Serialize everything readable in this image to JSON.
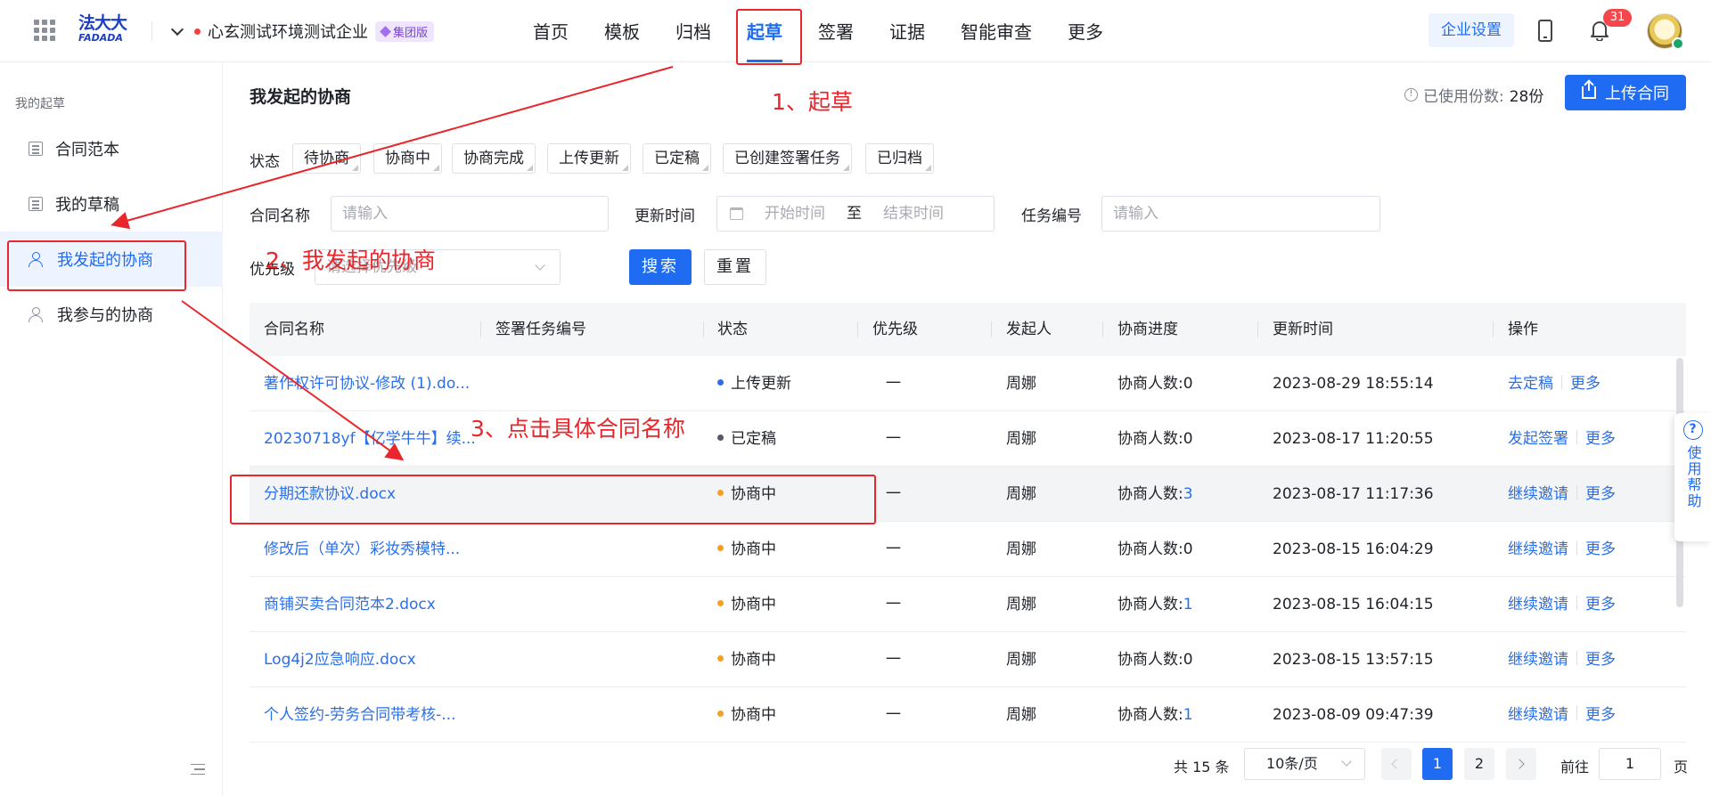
{
  "topbar": {
    "logo_cn": "法大大",
    "logo_en": "FADADA",
    "org_name": "心玄测试环境测试企业",
    "org_tag": "集团版",
    "nav": [
      "首页",
      "模板",
      "归档",
      "起草",
      "签署",
      "证据",
      "智能审查",
      "更多"
    ],
    "active_nav": "起草",
    "enterprise_settings": "企业设置",
    "notification_count": "31"
  },
  "sidebar": {
    "section_title": "我的起草",
    "items": [
      {
        "label": "合同范本"
      },
      {
        "label": "我的草稿"
      },
      {
        "label": "我发起的协商"
      },
      {
        "label": "我参与的协商"
      }
    ]
  },
  "main": {
    "title": "我发起的协商",
    "used_label": "已使用份数:",
    "used_count": "28份",
    "upload_button": "上传合同",
    "filters": {
      "status_label": "状态",
      "statuses": [
        "待协商",
        "协商中",
        "协商完成",
        "上传更新",
        "已定稿",
        "已创建签署任务",
        "已归档"
      ],
      "contract_name_label": "合同名称",
      "contract_name_placeholder": "请输入",
      "update_time_label": "更新时间",
      "start_placeholder": "开始时间",
      "to_label": "至",
      "end_placeholder": "结束时间",
      "task_no_label": "任务编号",
      "task_no_placeholder": "请输入",
      "priority_label": "优先级",
      "priority_placeholder": "请选择优先级",
      "search_button": "搜索",
      "reset_button": "重置"
    },
    "table": {
      "columns": [
        "合同名称",
        "签署任务编号",
        "状态",
        "优先级",
        "发起人",
        "协商进度",
        "更新时间",
        "操作"
      ],
      "rows": [
        {
          "name": "著作权许可协议-修改 (1).do...",
          "task_no": "",
          "status": "上传更新",
          "status_color": "#2b6fe8",
          "priority": "一",
          "initiator": "周娜",
          "progress_label": "协商人数:",
          "progress_count": "0",
          "updated": "2023-08-29 18:55:14",
          "action": "去定稿",
          "more": "更多"
        },
        {
          "name": "20230718yf【亿学牛牛】续...",
          "task_no": "",
          "status": "已定稿",
          "status_color": "#555a63",
          "priority": "一",
          "initiator": "周娜",
          "progress_label": "协商人数:",
          "progress_count": "0",
          "updated": "2023-08-17 11:20:55",
          "action": "发起签署",
          "more": "更多"
        },
        {
          "name": "分期还款协议.docx",
          "task_no": "",
          "status": "协商中",
          "status_color": "#f5a020",
          "priority": "一",
          "initiator": "周娜",
          "progress_label": "协商人数:",
          "progress_count": "3",
          "updated": "2023-08-17 11:17:36",
          "action": "继续邀请",
          "more": "更多"
        },
        {
          "name": "修改后（单次）彩妆秀模特...",
          "task_no": "",
          "status": "协商中",
          "status_color": "#f5a020",
          "priority": "一",
          "initiator": "周娜",
          "progress_label": "协商人数:",
          "progress_count": "0",
          "updated": "2023-08-15 16:04:29",
          "action": "继续邀请",
          "more": "更多"
        },
        {
          "name": "商铺买卖合同范本2.docx",
          "task_no": "",
          "status": "协商中",
          "status_color": "#f5a020",
          "priority": "一",
          "initiator": "周娜",
          "progress_label": "协商人数:",
          "progress_count": "1",
          "updated": "2023-08-15 16:04:15",
          "action": "继续邀请",
          "more": "更多"
        },
        {
          "name": "Log4j2应急响应.docx",
          "task_no": "",
          "status": "协商中",
          "status_color": "#f5a020",
          "priority": "一",
          "initiator": "周娜",
          "progress_label": "协商人数:",
          "progress_count": "0",
          "updated": "2023-08-15 13:57:15",
          "action": "继续邀请",
          "more": "更多"
        },
        {
          "name": "个人签约-劳务合同带考核-...",
          "task_no": "",
          "status": "协商中",
          "status_color": "#f5a020",
          "priority": "一",
          "initiator": "周娜",
          "progress_label": "协商人数:",
          "progress_count": "1",
          "updated": "2023-08-09 09:47:39",
          "action": "继续邀请",
          "more": "更多"
        }
      ]
    },
    "pagination": {
      "total": "共 15 条",
      "page_size": "10条/页",
      "pages": [
        "1",
        "2"
      ],
      "current": "1",
      "goto_label": "前往",
      "goto_value": "1",
      "page_suffix": "页"
    }
  },
  "help": {
    "text": "使用帮助"
  },
  "annotations": {
    "step1": "1、起草",
    "step2": "2、我发起的协商",
    "step3": "3、点击具体合同名称",
    "color": "#e8262b"
  }
}
